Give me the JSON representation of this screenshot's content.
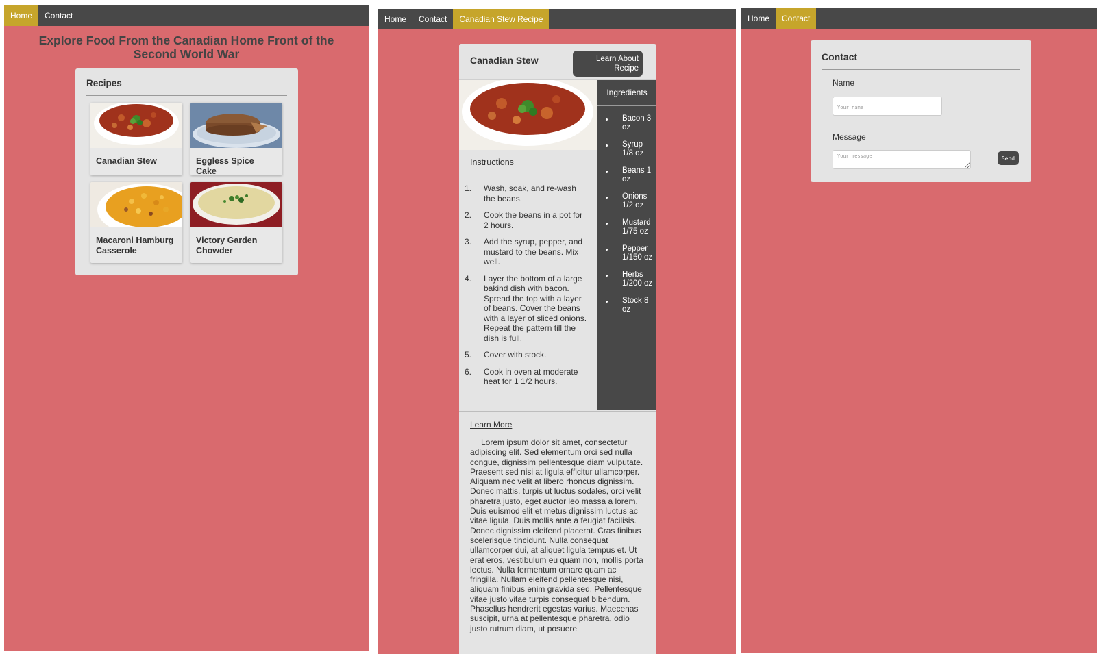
{
  "home": {
    "nav": [
      {
        "label": "Home",
        "active": true
      },
      {
        "label": "Contact",
        "active": false
      }
    ],
    "title": "Explore Food From the Canadian Home Front of the Second World War",
    "recipes_heading": "Recipes",
    "recipes": [
      {
        "label": "Canadian Stew",
        "image": "stew-photo"
      },
      {
        "label": "Eggless Spice Cake",
        "image": "cake-photo"
      },
      {
        "label": "Macaroni Hamburg Casserole",
        "image": "macaroni-photo"
      },
      {
        "label": "Victory Garden Chowder",
        "image": "chowder-photo"
      }
    ]
  },
  "recipe": {
    "nav": [
      {
        "label": "Home",
        "active": false
      },
      {
        "label": "Contact",
        "active": false
      },
      {
        "label": "Canadian Stew Recipe",
        "active": true
      }
    ],
    "title": "Canadian Stew",
    "learn_button": "Learn About Recipe",
    "instructions_tab": "Instructions",
    "ingredients_tab": "Ingredients",
    "instructions": [
      {
        "num": "1.",
        "text": "Wash, soak, and re-wash the beans."
      },
      {
        "num": "2.",
        "text": "Cook the beans in a pot for 2 hours."
      },
      {
        "num": "3.",
        "text": "Add the syrup, pepper, and mustard to the beans. Mix well."
      },
      {
        "num": "4.",
        "text": "Layer the bottom of a large bakind dish with bacon. Spread the top with a layer of beans. Cover the beans with a layer of sliced onions. Repeat the pattern till the dish is full."
      },
      {
        "num": "5.",
        "text": "Cover with stock."
      },
      {
        "num": "6.",
        "text": "Cook in oven at moderate heat for 1 1/2 hours."
      }
    ],
    "ingredients": [
      "Bacon 3 oz",
      "Syrup 1/8 oz",
      "Beans 1 oz",
      "Onions 1/2 oz",
      "Mustard 1/75 oz",
      "Pepper 1/150 oz",
      "Herbs 1/200 oz",
      "Stock 8 oz"
    ],
    "learn_more": "Learn More",
    "lorem": "Lorem ipsum dolor sit amet, consectetur adipiscing elit. Sed elementum orci sed nulla congue, dignissim pellentesque diam vulputate. Praesent sed nisi at ligula efficitur ullamcorper. Aliquam nec velit at libero rhoncus dignissim. Donec mattis, turpis ut luctus sodales, orci velit pharetra justo, eget auctor leo massa a lorem. Duis euismod elit et metus dignissim luctus ac vitae ligula. Duis mollis ante a feugiat facilisis. Donec dignissim eleifend placerat. Cras finibus scelerisque tincidunt. Nulla consequat ullamcorper dui, at aliquet ligula tempus et. Ut erat eros, vestibulum eu quam non, mollis porta lectus. Nulla fermentum ornare quam ac fringilla. Nullam eleifend pellentesque nisi, aliquam finibus enim gravida sed. Pellentesque vitae justo vitae turpis consequat bibendum. Phasellus hendrerit egestas varius. Maecenas suscipit, urna at pellentesque pharetra, odio justo rutrum diam, ut posuere"
  },
  "contact": {
    "nav": [
      {
        "label": "Home",
        "active": false
      },
      {
        "label": "Contact",
        "active": true
      }
    ],
    "title": "Contact",
    "name_label": "Name",
    "name_placeholder": "Your name",
    "message_label": "Message",
    "message_placeholder": "Your message",
    "send_label": "Send"
  },
  "colors": {
    "background": "#d96a6e",
    "nav": "#484848",
    "accent": "#c6a52b",
    "card": "#e4e4e4"
  }
}
